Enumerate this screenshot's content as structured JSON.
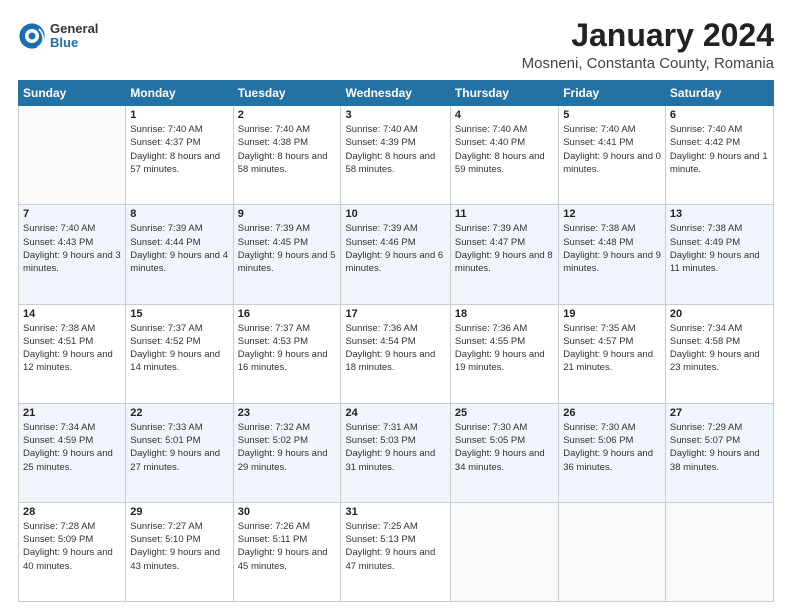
{
  "header": {
    "logo": {
      "general": "General",
      "blue": "Blue"
    },
    "title": "January 2024",
    "location": "Mosneni, Constanta County, Romania"
  },
  "weekdays": [
    "Sunday",
    "Monday",
    "Tuesday",
    "Wednesday",
    "Thursday",
    "Friday",
    "Saturday"
  ],
  "weeks": [
    [
      {
        "day": "",
        "sunrise": "",
        "sunset": "",
        "daylight": ""
      },
      {
        "day": "1",
        "sunrise": "Sunrise: 7:40 AM",
        "sunset": "Sunset: 4:37 PM",
        "daylight": "Daylight: 8 hours and 57 minutes."
      },
      {
        "day": "2",
        "sunrise": "Sunrise: 7:40 AM",
        "sunset": "Sunset: 4:38 PM",
        "daylight": "Daylight: 8 hours and 58 minutes."
      },
      {
        "day": "3",
        "sunrise": "Sunrise: 7:40 AM",
        "sunset": "Sunset: 4:39 PM",
        "daylight": "Daylight: 8 hours and 58 minutes."
      },
      {
        "day": "4",
        "sunrise": "Sunrise: 7:40 AM",
        "sunset": "Sunset: 4:40 PM",
        "daylight": "Daylight: 8 hours and 59 minutes."
      },
      {
        "day": "5",
        "sunrise": "Sunrise: 7:40 AM",
        "sunset": "Sunset: 4:41 PM",
        "daylight": "Daylight: 9 hours and 0 minutes."
      },
      {
        "day": "6",
        "sunrise": "Sunrise: 7:40 AM",
        "sunset": "Sunset: 4:42 PM",
        "daylight": "Daylight: 9 hours and 1 minute."
      }
    ],
    [
      {
        "day": "7",
        "sunrise": "Sunrise: 7:40 AM",
        "sunset": "Sunset: 4:43 PM",
        "daylight": "Daylight: 9 hours and 3 minutes."
      },
      {
        "day": "8",
        "sunrise": "Sunrise: 7:39 AM",
        "sunset": "Sunset: 4:44 PM",
        "daylight": "Daylight: 9 hours and 4 minutes."
      },
      {
        "day": "9",
        "sunrise": "Sunrise: 7:39 AM",
        "sunset": "Sunset: 4:45 PM",
        "daylight": "Daylight: 9 hours and 5 minutes."
      },
      {
        "day": "10",
        "sunrise": "Sunrise: 7:39 AM",
        "sunset": "Sunset: 4:46 PM",
        "daylight": "Daylight: 9 hours and 6 minutes."
      },
      {
        "day": "11",
        "sunrise": "Sunrise: 7:39 AM",
        "sunset": "Sunset: 4:47 PM",
        "daylight": "Daylight: 9 hours and 8 minutes."
      },
      {
        "day": "12",
        "sunrise": "Sunrise: 7:38 AM",
        "sunset": "Sunset: 4:48 PM",
        "daylight": "Daylight: 9 hours and 9 minutes."
      },
      {
        "day": "13",
        "sunrise": "Sunrise: 7:38 AM",
        "sunset": "Sunset: 4:49 PM",
        "daylight": "Daylight: 9 hours and 11 minutes."
      }
    ],
    [
      {
        "day": "14",
        "sunrise": "Sunrise: 7:38 AM",
        "sunset": "Sunset: 4:51 PM",
        "daylight": "Daylight: 9 hours and 12 minutes."
      },
      {
        "day": "15",
        "sunrise": "Sunrise: 7:37 AM",
        "sunset": "Sunset: 4:52 PM",
        "daylight": "Daylight: 9 hours and 14 minutes."
      },
      {
        "day": "16",
        "sunrise": "Sunrise: 7:37 AM",
        "sunset": "Sunset: 4:53 PM",
        "daylight": "Daylight: 9 hours and 16 minutes."
      },
      {
        "day": "17",
        "sunrise": "Sunrise: 7:36 AM",
        "sunset": "Sunset: 4:54 PM",
        "daylight": "Daylight: 9 hours and 18 minutes."
      },
      {
        "day": "18",
        "sunrise": "Sunrise: 7:36 AM",
        "sunset": "Sunset: 4:55 PM",
        "daylight": "Daylight: 9 hours and 19 minutes."
      },
      {
        "day": "19",
        "sunrise": "Sunrise: 7:35 AM",
        "sunset": "Sunset: 4:57 PM",
        "daylight": "Daylight: 9 hours and 21 minutes."
      },
      {
        "day": "20",
        "sunrise": "Sunrise: 7:34 AM",
        "sunset": "Sunset: 4:58 PM",
        "daylight": "Daylight: 9 hours and 23 minutes."
      }
    ],
    [
      {
        "day": "21",
        "sunrise": "Sunrise: 7:34 AM",
        "sunset": "Sunset: 4:59 PM",
        "daylight": "Daylight: 9 hours and 25 minutes."
      },
      {
        "day": "22",
        "sunrise": "Sunrise: 7:33 AM",
        "sunset": "Sunset: 5:01 PM",
        "daylight": "Daylight: 9 hours and 27 minutes."
      },
      {
        "day": "23",
        "sunrise": "Sunrise: 7:32 AM",
        "sunset": "Sunset: 5:02 PM",
        "daylight": "Daylight: 9 hours and 29 minutes."
      },
      {
        "day": "24",
        "sunrise": "Sunrise: 7:31 AM",
        "sunset": "Sunset: 5:03 PM",
        "daylight": "Daylight: 9 hours and 31 minutes."
      },
      {
        "day": "25",
        "sunrise": "Sunrise: 7:30 AM",
        "sunset": "Sunset: 5:05 PM",
        "daylight": "Daylight: 9 hours and 34 minutes."
      },
      {
        "day": "26",
        "sunrise": "Sunrise: 7:30 AM",
        "sunset": "Sunset: 5:06 PM",
        "daylight": "Daylight: 9 hours and 36 minutes."
      },
      {
        "day": "27",
        "sunrise": "Sunrise: 7:29 AM",
        "sunset": "Sunset: 5:07 PM",
        "daylight": "Daylight: 9 hours and 38 minutes."
      }
    ],
    [
      {
        "day": "28",
        "sunrise": "Sunrise: 7:28 AM",
        "sunset": "Sunset: 5:09 PM",
        "daylight": "Daylight: 9 hours and 40 minutes."
      },
      {
        "day": "29",
        "sunrise": "Sunrise: 7:27 AM",
        "sunset": "Sunset: 5:10 PM",
        "daylight": "Daylight: 9 hours and 43 minutes."
      },
      {
        "day": "30",
        "sunrise": "Sunrise: 7:26 AM",
        "sunset": "Sunset: 5:11 PM",
        "daylight": "Daylight: 9 hours and 45 minutes."
      },
      {
        "day": "31",
        "sunrise": "Sunrise: 7:25 AM",
        "sunset": "Sunset: 5:13 PM",
        "daylight": "Daylight: 9 hours and 47 minutes."
      },
      {
        "day": "",
        "sunrise": "",
        "sunset": "",
        "daylight": ""
      },
      {
        "day": "",
        "sunrise": "",
        "sunset": "",
        "daylight": ""
      },
      {
        "day": "",
        "sunrise": "",
        "sunset": "",
        "daylight": ""
      }
    ]
  ]
}
